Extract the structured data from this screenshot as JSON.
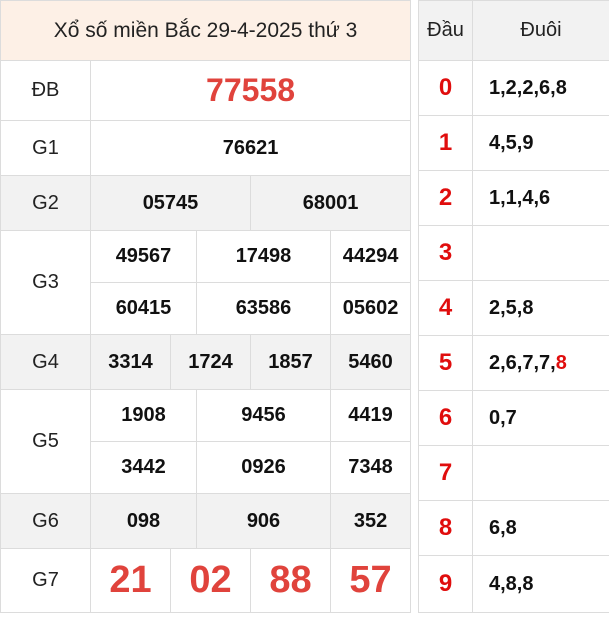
{
  "results": {
    "title": "Xổ số miền Bắc 29-4-2025 thứ 3",
    "prizes": {
      "db": {
        "label": "ĐB",
        "numbers": [
          "77558"
        ]
      },
      "g1": {
        "label": "G1",
        "numbers": [
          "76621"
        ]
      },
      "g2": {
        "label": "G2",
        "numbers": [
          "05745",
          "68001"
        ]
      },
      "g3": {
        "label": "G3",
        "numbers": [
          "49567",
          "17498",
          "44294",
          "60415",
          "63586",
          "05602"
        ]
      },
      "g4": {
        "label": "G4",
        "numbers": [
          "3314",
          "1724",
          "1857",
          "5460"
        ]
      },
      "g5": {
        "label": "G5",
        "numbers": [
          "1908",
          "9456",
          "4419",
          "3442",
          "0926",
          "7348"
        ]
      },
      "g6": {
        "label": "G6",
        "numbers": [
          "098",
          "906",
          "352"
        ]
      },
      "g7": {
        "label": "G7",
        "numbers": [
          "21",
          "02",
          "88",
          "57"
        ]
      }
    }
  },
  "loto": {
    "head_label": "Đầu",
    "tail_label": "Đuôi",
    "rows": [
      {
        "head": "0",
        "tail": "1,2,2,6,8"
      },
      {
        "head": "1",
        "tail": "4,5,9"
      },
      {
        "head": "2",
        "tail": "1,1,4,6"
      },
      {
        "head": "3",
        "tail": ""
      },
      {
        "head": "4",
        "tail": "2,5,8"
      },
      {
        "head": "5",
        "tail": "2,6,7,7,",
        "tail_highlight": "8"
      },
      {
        "head": "6",
        "tail": "0,7"
      },
      {
        "head": "7",
        "tail": ""
      },
      {
        "head": "8",
        "tail": "6,8"
      },
      {
        "head": "9",
        "tail": "4,8,8"
      }
    ]
  },
  "colors": {
    "accent_red": "#e0433c",
    "head_red": "#e00d0d",
    "title_bg": "#fdf0e6",
    "row_grey": "#f2f2f2"
  }
}
